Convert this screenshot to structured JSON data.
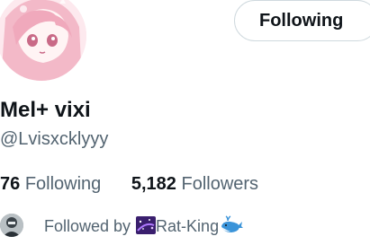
{
  "profile": {
    "display_name": "Mel+ vixi",
    "handle": "@Lvisxcklyyy"
  },
  "actions": {
    "follow_state_label": "Following"
  },
  "stats": {
    "following_count": "76",
    "following_label": "Following",
    "followers_count": "5,182",
    "followers_label": "Followers"
  },
  "followed_by": {
    "prefix": "Followed by",
    "follower_name": "Rat-King",
    "left_icon": "galaxy-emoji-icon",
    "right_icon": "whale-emoji-icon"
  },
  "colors": {
    "primary_text": "#0f1419",
    "secondary_text": "#536471",
    "border": "#cfd9de",
    "avatar_bg": "#fbe6ec"
  }
}
